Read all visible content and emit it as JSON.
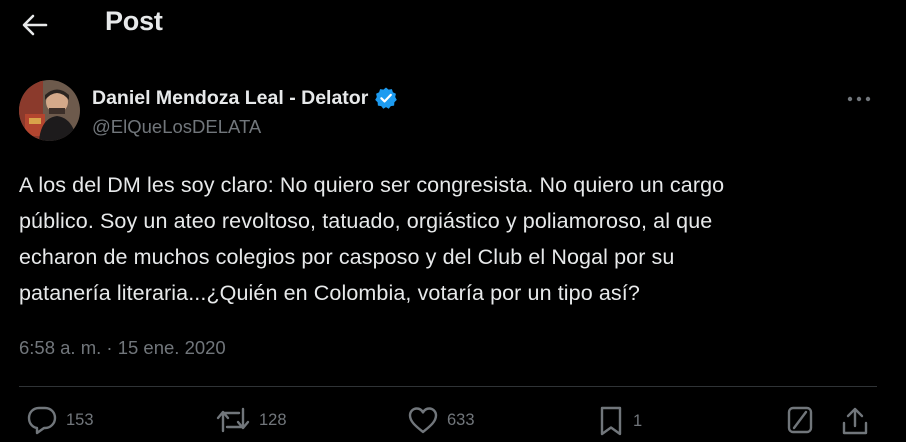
{
  "header": {
    "title": "Post",
    "back_icon": "arrow-left-icon"
  },
  "author": {
    "display_name": "Daniel Mendoza Leal - Delator",
    "handle": "@ElQueLosDELATA",
    "verified_icon": "verified-badge-icon",
    "verified_color": "#1d9bf0",
    "more_icon": "ellipsis-icon"
  },
  "tweet": {
    "text": "A los del DM les soy claro: No quiero ser congresista. No quiero un cargo\npúblico. Soy un ateo revoltoso, tatuado, orgiástico y poliamoroso, al que\necharon de muchos colegios por casposo y del Club el Nogal por su\npatanería literaria...¿Quién en Colombia, votaría por un tipo así?",
    "timestamp": "6:58 a. m. · 15 ene. 2020"
  },
  "actions": {
    "replies": "153",
    "reposts": "128",
    "likes": "633",
    "bookmarks": "1"
  },
  "colors": {
    "background": "#000000",
    "text_primary": "#e7e9ea",
    "text_secondary": "#71767b",
    "divider": "#2f3336"
  }
}
